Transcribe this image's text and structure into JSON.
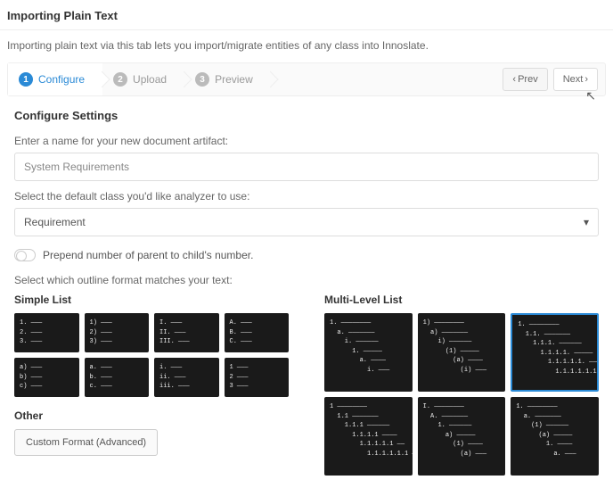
{
  "page": {
    "title": "Importing Plain Text",
    "description": "Importing plain text via this tab lets you import/migrate entities of any class into Innoslate."
  },
  "stepper": {
    "steps": [
      {
        "num": "1",
        "label": "Configure",
        "active": true
      },
      {
        "num": "2",
        "label": "Upload",
        "active": false
      },
      {
        "num": "3",
        "label": "Preview",
        "active": false
      }
    ],
    "prev": "Prev",
    "next": "Next"
  },
  "settings": {
    "title": "Configure Settings",
    "name_label": "Enter a name for your new document artifact:",
    "name_value": "System Requirements",
    "class_label": "Select the default class you'd like analyzer to use:",
    "class_value": "Requirement",
    "prepend_label": "Prepend number of parent to child's number.",
    "outline_label": "Select which outline format matches your text:"
  },
  "lists": {
    "simple_title": "Simple List",
    "multi_title": "Multi-Level List",
    "other_title": "Other",
    "custom_button": "Custom Format (Advanced)",
    "simple": [
      "1. ———\n2. ———\n3. ———",
      "1) ———\n2) ———\n3) ———",
      "I. ———\nII. ———\nIII. ———",
      "A. ———\nB. ———\nC. ———",
      "a) ———\nb) ———\nc) ———",
      "a. ———\nb. ———\nc. ———",
      "i. ———\nii. ———\niii. ———",
      "1 ———\n2 ———\n3 ———"
    ],
    "multi": [
      {
        "text": "1. ————————\n  a. ———————\n    i. ——————\n      1. —————\n        a. ————\n          i. ———",
        "selected": false
      },
      {
        "text": "1) ————————\n  a) ———————\n    i) ——————\n      (1) —————\n        (a) ————\n          (i) ———",
        "selected": false
      },
      {
        "text": "1. ————————\n  1.1. ———————\n    1.1.1. ——————\n      1.1.1.1. —————\n        1.1.1.1.1. ———\n          1.1.1.1.1.1. —",
        "selected": true
      },
      {
        "text": "1 ————————\n  1.1 ———————\n    1.1.1 ——————\n      1.1.1.1 ————\n        1.1.1.1.1 ——\n          1.1.1.1.1.1 —",
        "selected": false
      },
      {
        "text": "I. ————————\n  A. ———————\n    1. ——————\n      a) —————\n        (1) ————\n          (a) ———",
        "selected": false
      },
      {
        "text": "1. ————————\n  a. ———————\n    (1) ——————\n      (a) —————\n        1. ————\n          a. ———",
        "selected": false
      }
    ]
  }
}
